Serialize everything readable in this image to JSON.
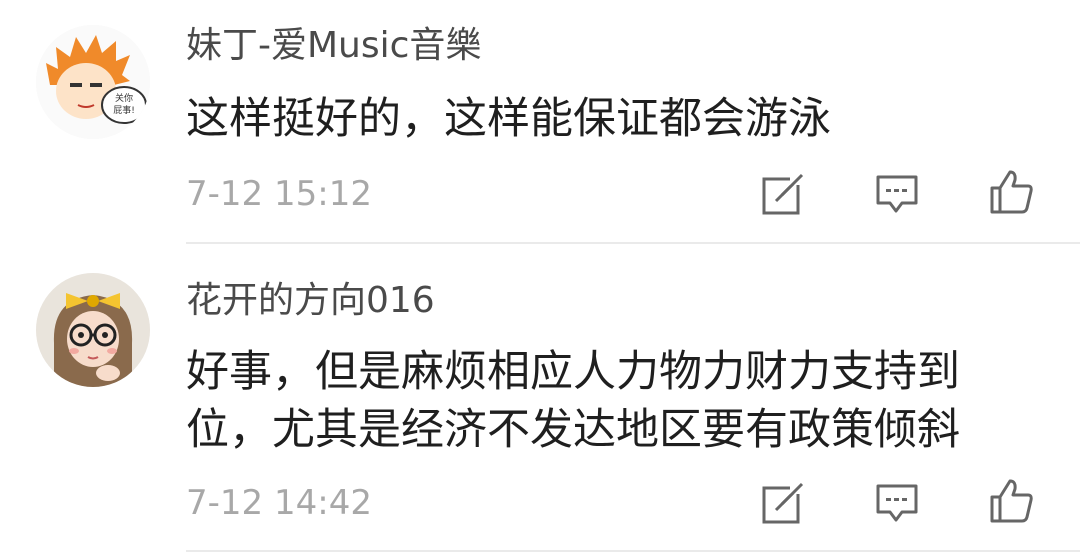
{
  "comments": [
    {
      "username": "妹丁-爱Music音樂",
      "content": "这样挺好的，这样能保证都会游泳",
      "time": "7-12 15:12",
      "avatar_text": "关你屁事!"
    },
    {
      "username": "花开的方向016",
      "content": "好事，但是麻烦相应人力物力财力支持到位，尤其是经济不发达地区要有政策倾斜",
      "time": "7-12 14:42"
    }
  ],
  "icons": {
    "edit": "edit-icon",
    "reply": "comment-icon",
    "like": "thumbs-up-icon"
  },
  "colors": {
    "username": "#4a4a4a",
    "content": "#1f1f1f",
    "time": "#a8a8a8",
    "icon": "#666666",
    "divider": "#eaeaea"
  }
}
